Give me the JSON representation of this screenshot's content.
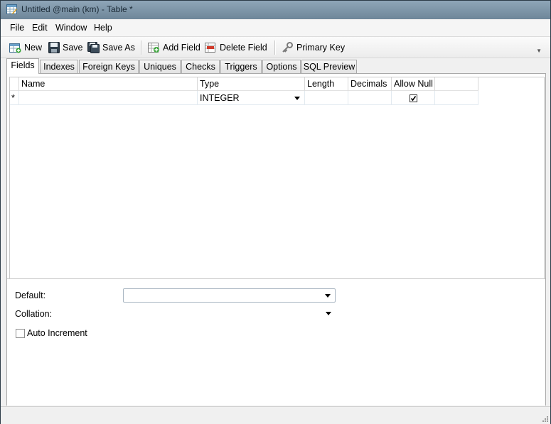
{
  "window": {
    "title": "Untitled @main (km) - Table *"
  },
  "menu": {
    "items": [
      "File",
      "Edit",
      "Window",
      "Help"
    ]
  },
  "toolbar": {
    "new_label": "New",
    "save_label": "Save",
    "save_as_label": "Save As",
    "add_field_label": "Add Field",
    "delete_field_label": "Delete Field",
    "primary_key_label": "Primary Key"
  },
  "tabs": [
    "Fields",
    "Indexes",
    "Foreign Keys",
    "Uniques",
    "Checks",
    "Triggers",
    "Options",
    "SQL Preview"
  ],
  "active_tab": "Fields",
  "grid": {
    "columns": [
      "Name",
      "Type",
      "Length",
      "Decimals",
      "Allow Null"
    ],
    "rows": [
      {
        "marker": "*",
        "name": "",
        "type": "INTEGER",
        "length": "",
        "decimals": "",
        "allow_null": true
      }
    ]
  },
  "properties": {
    "default_label": "Default:",
    "default_value": "",
    "collation_label": "Collation:",
    "collation_value": "",
    "auto_increment_label": "Auto Increment",
    "auto_increment_checked": false
  },
  "colors": {
    "titlebar": "#7f96a8",
    "grid_line": "#e2eaf0"
  },
  "icons": [
    "table-icon",
    "new-table-icon",
    "save-icon",
    "save-as-icon",
    "add-field-icon",
    "delete-field-icon",
    "key-icon",
    "check-icon"
  ]
}
